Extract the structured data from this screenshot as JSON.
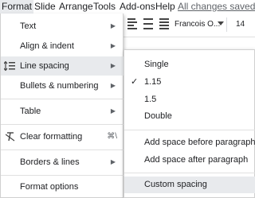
{
  "menubar": {
    "items": [
      "Format",
      "Slide",
      "Arrange",
      "Tools",
      "Add-ons",
      "Help"
    ],
    "saved_status": "All changes saved in D"
  },
  "toolbar": {
    "font": "Francois O...",
    "font_size": "14"
  },
  "format_menu": {
    "items": [
      {
        "label": "Text",
        "submenu": true
      },
      {
        "label": "Align & indent",
        "submenu": true
      },
      {
        "label": "Line spacing",
        "submenu": true,
        "icon": "line-spacing-icon"
      },
      {
        "label": "Bullets & numbering",
        "submenu": true
      },
      {
        "label": "Table",
        "submenu": true
      },
      {
        "label": "Clear formatting",
        "shortcut": "⌘\\",
        "icon": "clear-formatting-icon"
      },
      {
        "label": "Borders & lines",
        "submenu": true
      },
      {
        "label": "Format options"
      }
    ]
  },
  "line_spacing_menu": {
    "items": [
      {
        "label": "Single"
      },
      {
        "label": "1.15",
        "checked": true
      },
      {
        "label": "1.5"
      },
      {
        "label": "Double"
      },
      {
        "label": "Add space before paragraph"
      },
      {
        "label": "Add space after paragraph"
      },
      {
        "label": "Custom spacing"
      }
    ]
  },
  "colors": {
    "highlight": "#e8eaed",
    "text": "#202124",
    "muted": "#5f6368"
  }
}
